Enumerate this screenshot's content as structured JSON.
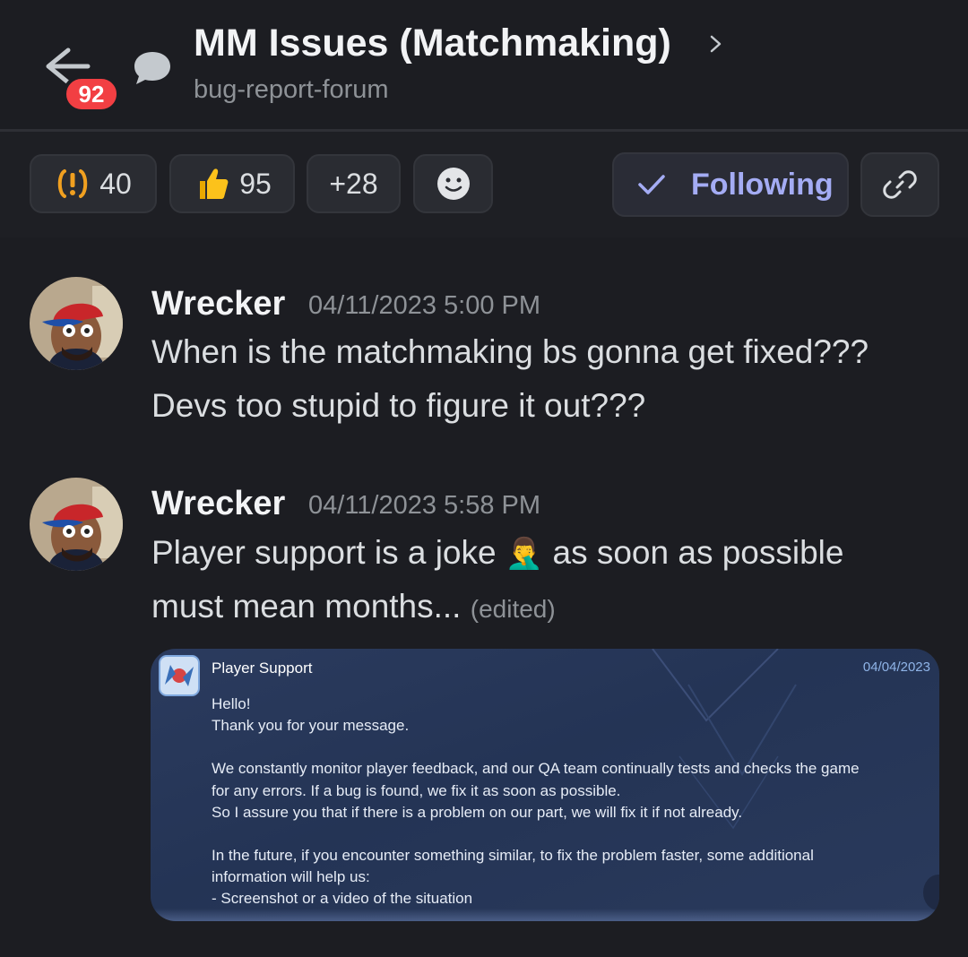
{
  "header": {
    "title": "MM Issues (Matchmaking)",
    "channel": "bug-report-forum",
    "unread_badge": "92"
  },
  "reactions": [
    {
      "emoji": "exclamation",
      "count": "40"
    },
    {
      "emoji": "thumbs-up",
      "count": "95"
    },
    {
      "label": "+28"
    }
  ],
  "follow_label": "Following",
  "messages": [
    {
      "author": "Wrecker",
      "timestamp": "04/11/2023 5:00 PM",
      "lines": [
        "When is the matchmaking bs gonna get fixed???",
        "Devs too stupid to figure it out???"
      ]
    },
    {
      "author": "Wrecker",
      "timestamp": "04/11/2023 5:58 PM",
      "line1_a": "Player support is a joke",
      "line1_emoji": "🤦‍♂️",
      "line1_b": "as soon as possible",
      "line2": "must mean months...",
      "edited": "(edited)"
    }
  ],
  "attachment": {
    "sender": "Player Support",
    "date": "04/04/2023",
    "lines": [
      "Hello!",
      "Thank you for your message.",
      "",
      "We constantly monitor player feedback, and our QA team continually tests and checks the game",
      "for any errors. If a bug is found, we fix it as soon as possible.",
      "So I assure you that if there is a problem on our part, we will fix it if not already.",
      "",
      "In the future, if you encounter something similar, to fix the problem faster, some additional",
      "information will help us:",
      "- Screenshot or a video of the situation"
    ]
  },
  "colors": {
    "background": "#1c1d22",
    "badge": "#f23f43",
    "following": "#a4acf4",
    "embed": "#27375a"
  }
}
